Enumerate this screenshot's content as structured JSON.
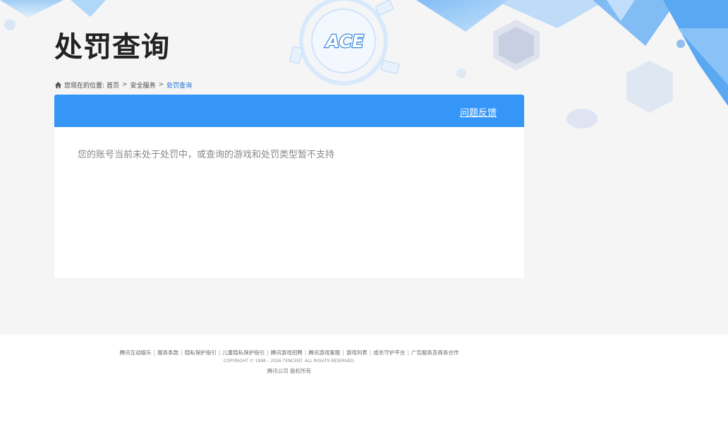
{
  "page": {
    "title": "处罚查询",
    "logo_text": "ACE"
  },
  "breadcrumb": {
    "prefix": "您现在的位置:",
    "items": [
      "首页",
      "安全服务",
      "处罚查询"
    ],
    "separator": ">"
  },
  "panel": {
    "feedback_label": "问题反馈",
    "message": "您的账号当前未处于处罚中，或查询的游戏和处罚类型暂不支持"
  },
  "footer": {
    "links": [
      "腾讯互动娱乐",
      "服务条款",
      "隐私保护指引",
      "儿童隐私保护指引",
      "腾讯游戏招聘",
      "腾讯游戏客服",
      "游戏列表",
      "成长守护平台",
      "广告服务及商务合作"
    ],
    "link_separator": "|",
    "copyright": "COPYRIGHT © 1998 – 2026 TENCENT. ALL RIGHTS RESERVED.",
    "rights": "腾讯公司 版权所有"
  },
  "colors": {
    "header_blue": "#3596f8",
    "breadcrumb_current": "#1e6fd0",
    "background": "#f5f5f6"
  }
}
